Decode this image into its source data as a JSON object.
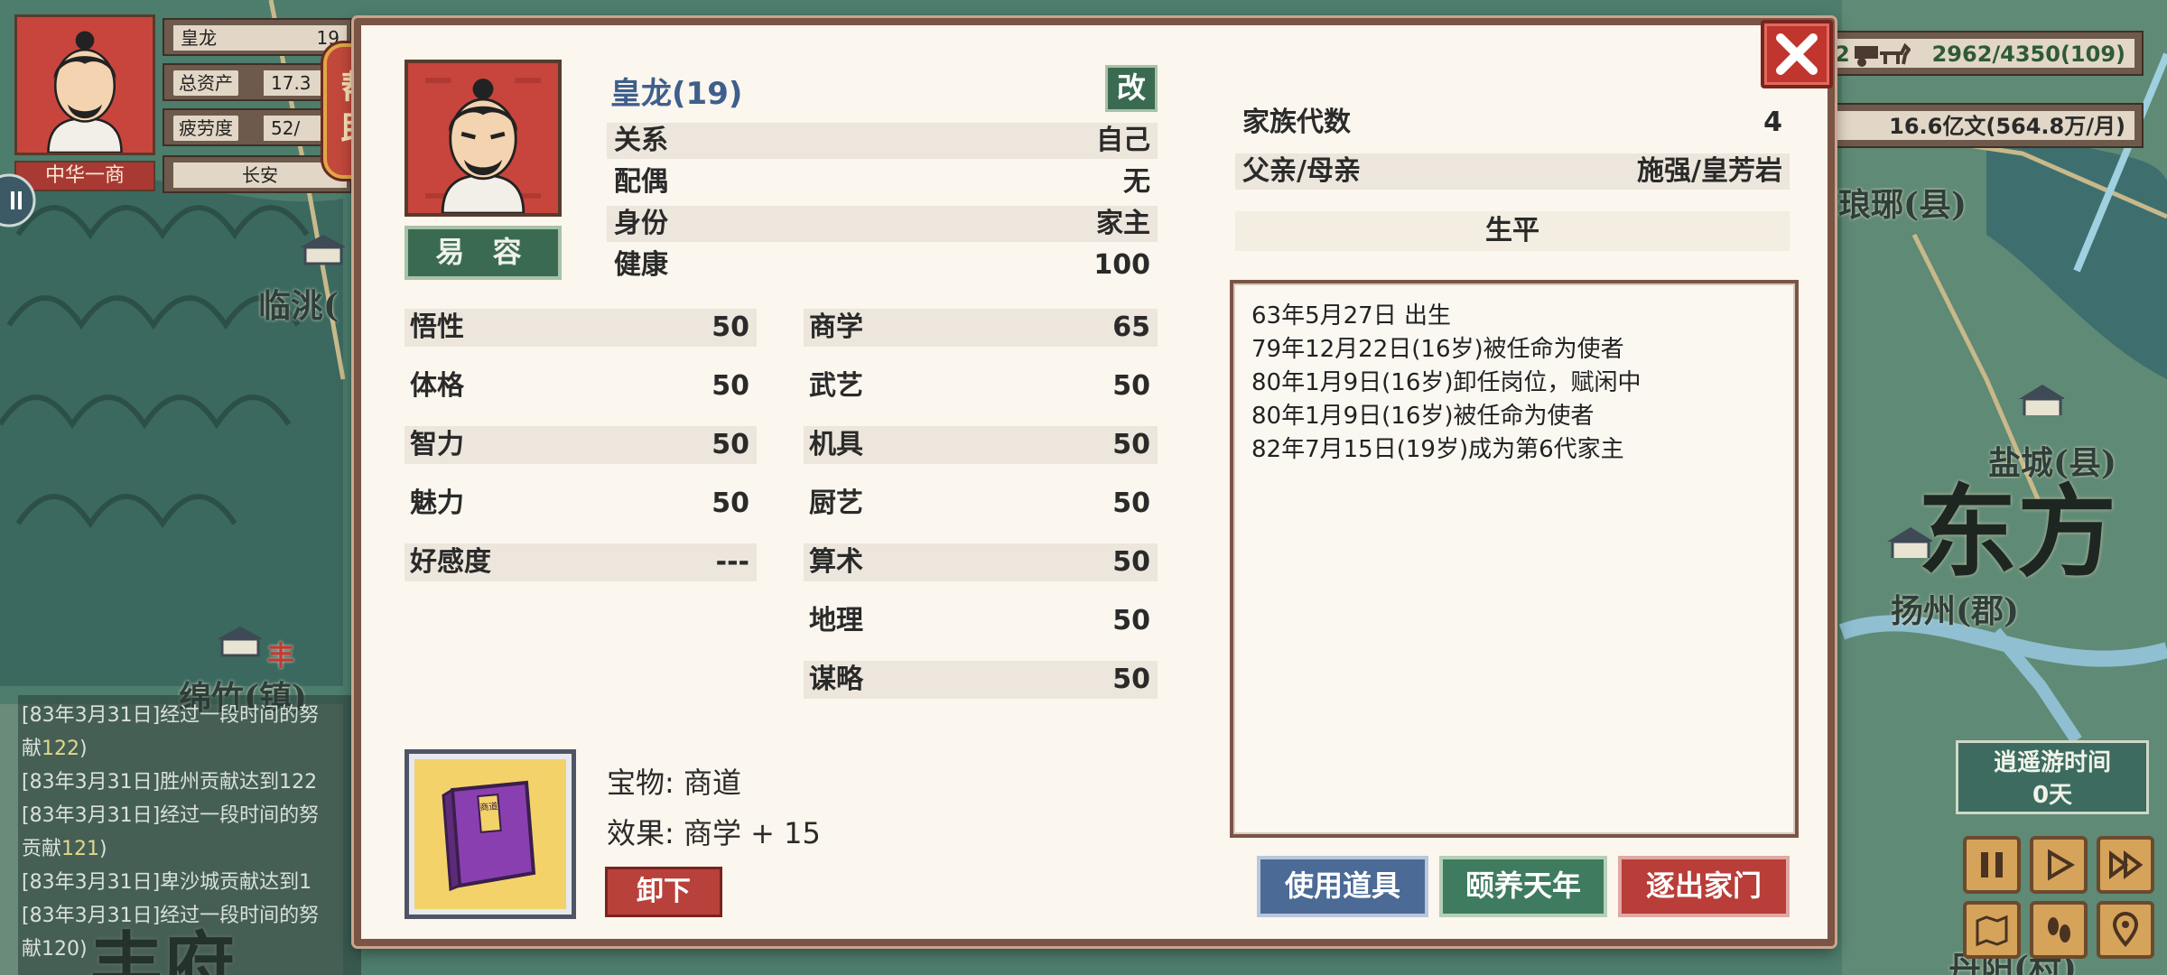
{
  "hud": {
    "name": "皇龙",
    "age": "19",
    "assets_label": "总资产",
    "assets_value": "17.3",
    "fatigue_label": "疲劳度",
    "fatigue_value": "52/",
    "location": "长安",
    "title": "中华一商",
    "help_label": "帮助",
    "transport": "2962/4350(109)",
    "transport_prefix": "2",
    "money": "16.6亿文(564.8万/月)",
    "idle_label": "逍遥游时间",
    "idle_value": "0天"
  },
  "map_labels": {
    "linyao": "临洮(",
    "langye": "琅琊(县)",
    "yancheng": "盐城(县)",
    "dongfang": "东方",
    "yangzhou": "扬州(郡)",
    "mianzhu": "绵竹(镇)",
    "danyang": "丹阳(村)",
    "feng": "丰",
    "bottom_left": "丰府"
  },
  "log": [
    {
      "pre": "[83年3月31日]经过一段时间的努",
      "post": ""
    },
    {
      "pre": "献",
      "hl": "122",
      "post": ")"
    },
    {
      "pre": "[83年3月31日]胜州贡献达到122",
      "post": ""
    },
    {
      "pre": "[83年3月31日]经过一段时间的努",
      "post": ""
    },
    {
      "pre": "贡献",
      "hl": "121",
      "post": ")"
    },
    {
      "pre": "[83年3月31日]卑沙城贡献达到1",
      "post": ""
    },
    {
      "pre": "[83年3月31日]经过一段时间的努",
      "post": ""
    },
    {
      "pre": "献120)",
      "post": ""
    }
  ],
  "character": {
    "name": "皇龙(19)",
    "edit": "改",
    "disguise": "易 容",
    "info": [
      {
        "label": "关系",
        "value": "自己"
      },
      {
        "label": "配偶",
        "value": "无"
      },
      {
        "label": "身份",
        "value": "家主"
      },
      {
        "label": "健康",
        "value": "100"
      }
    ],
    "stats_left": [
      {
        "label": "悟性",
        "value": "50"
      },
      {
        "label": "体格",
        "value": "50"
      },
      {
        "label": "智力",
        "value": "50"
      },
      {
        "label": "魅力",
        "value": "50"
      },
      {
        "label": "好感度",
        "value": "---"
      }
    ],
    "stats_right": [
      {
        "label": "商学",
        "value": "65"
      },
      {
        "label": "武艺",
        "value": "50"
      },
      {
        "label": "机具",
        "value": "50"
      },
      {
        "label": "厨艺",
        "value": "50"
      },
      {
        "label": "算术",
        "value": "50"
      },
      {
        "label": "地理",
        "value": "50"
      },
      {
        "label": "谋略",
        "value": "50"
      }
    ]
  },
  "family": {
    "generation_label": "家族代数",
    "generation_value": "4",
    "parents_label": "父亲/母亲",
    "parents_value": "施强/皇芳岩",
    "bio_title": "生平",
    "bio": [
      "63年5月27日 出生",
      "79年12月22日(16岁)被任命为使者",
      "80年1月9日(16岁)卸任岗位，赋闲中",
      "80年1月9日(16岁)被任命为使者",
      "82年7月15日(19岁)成为第6代家主"
    ]
  },
  "treasure": {
    "item_label": "宝物: 商道",
    "effect_label": "效果: 商学 + 15",
    "book_title": "商道",
    "unequip": "卸下"
  },
  "actions": {
    "use_item": "使用道具",
    "retire": "颐养天年",
    "expel": "逐出家门"
  }
}
